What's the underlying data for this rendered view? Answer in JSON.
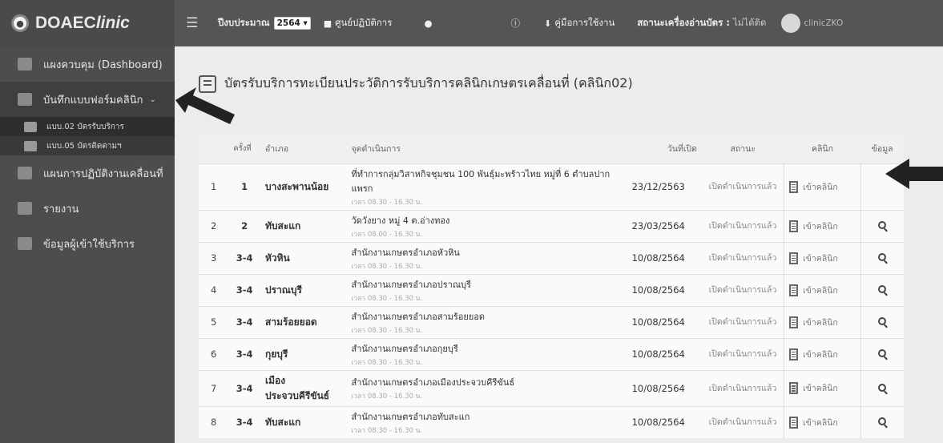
{
  "app": {
    "brand_prefix": "DOAEC",
    "brand_suffix": "linic"
  },
  "topbar": {
    "fiscal_year_label": "ปีงบประมาณ",
    "fiscal_year_value": "2564",
    "service_center_label": "ศูนย์ปฏิบัติการ",
    "manual_label": "คู่มือการใช้งาน",
    "card_reader_label": "สถานะเครื่องอ่านบัตร :",
    "card_reader_value": "ไม่ได้ติด",
    "username": "clinicZKO"
  },
  "sidebar": {
    "items": [
      {
        "label": "แผงควบคุม (Dashboard)"
      },
      {
        "label": "บันทึกแบบฟอร์มคลินิก"
      },
      {
        "label": "แผนการปฏิบัติงานเคลื่อนที่"
      },
      {
        "label": "รายงาน"
      },
      {
        "label": "ข้อมูลผู้เข้าใช้บริการ"
      }
    ],
    "subitems": [
      {
        "label": "แบบ.02 บัตรรับบริการ"
      },
      {
        "label": "แบบ.05 บัตรติดตามฯ"
      }
    ]
  },
  "page": {
    "title": "บัตรรับบริการทะเบียนประวัติการรับบริการคลินิกเกษตรเคลื่อนที่ (คลินิก02)"
  },
  "table": {
    "headers": {
      "times": "ครั้งที่",
      "district": "อำเภอ",
      "location": "จุดดำเนินการ",
      "open_date": "วันที่เปิด",
      "status": "สถานะ",
      "clinic": "คลินิก",
      "info": "ข้อมูล"
    },
    "enter_clinic_label": "เข้าคลินิก",
    "rows": [
      {
        "no": "1",
        "times": "1",
        "district": "บางสะพานน้อย",
        "location": "ที่ทำการกลุ่มวิสาหกิจชุมชน 100 พันธุ์มะพร้าวไทย หมู่ที่ 6 ตำบลปากแพรก",
        "time": "เวลา 08.30 - 16.30 น.",
        "date": "23/12/2563",
        "status": "เปิดดำเนินการแล้ว",
        "has_search": false
      },
      {
        "no": "2",
        "times": "2",
        "district": "ทับสะแก",
        "location": "วัดวังยาง หมู่ 4 ต.อ่างทอง",
        "time": "เวลา 08.00 - 16.30 น.",
        "date": "23/03/2564",
        "status": "เปิดดำเนินการแล้ว",
        "has_search": true
      },
      {
        "no": "3",
        "times": "3-4",
        "district": "หัวหิน",
        "location": "สำนักงานเกษตรอำเภอหัวหิน",
        "time": "เวลา 08.30 - 16.30 น.",
        "date": "10/08/2564",
        "status": "เปิดดำเนินการแล้ว",
        "has_search": true
      },
      {
        "no": "4",
        "times": "3-4",
        "district": "ปราณบุรี",
        "location": "สำนักงานเกษตรอำเภอปราณบุรี",
        "time": "เวลา 08.30 - 16.30 น.",
        "date": "10/08/2564",
        "status": "เปิดดำเนินการแล้ว",
        "has_search": true
      },
      {
        "no": "5",
        "times": "3-4",
        "district": "สามร้อยยอด",
        "location": "สำนักงานเกษตรอำเภอสามร้อยยอด",
        "time": "เวลา 08.30 - 16.30 น.",
        "date": "10/08/2564",
        "status": "เปิดดำเนินการแล้ว",
        "has_search": true
      },
      {
        "no": "6",
        "times": "3-4",
        "district": "กุยบุรี",
        "location": "สำนักงานเกษตรอำเภอกุยบุรี",
        "time": "เวลา 08.30 - 16.30 น.",
        "date": "10/08/2564",
        "status": "เปิดดำเนินการแล้ว",
        "has_search": true
      },
      {
        "no": "7",
        "times": "3-4",
        "district": "เมืองประจวบคีรีขันธ์",
        "location": "สำนักงานเกษตรอำเภอเมืองประจวบคีรีขันธ์",
        "time": "เวลา 08.30 - 16.30 น.",
        "date": "10/08/2564",
        "status": "เปิดดำเนินการแล้ว",
        "has_search": true
      },
      {
        "no": "8",
        "times": "3-4",
        "district": "ทับสะแก",
        "location": "สำนักงานเกษตรอำเภอทับสะแก",
        "time": "เวลา 08.30 - 16.30 น.",
        "date": "10/08/2564",
        "status": "เปิดดำเนินการแล้ว",
        "has_search": true
      }
    ]
  }
}
